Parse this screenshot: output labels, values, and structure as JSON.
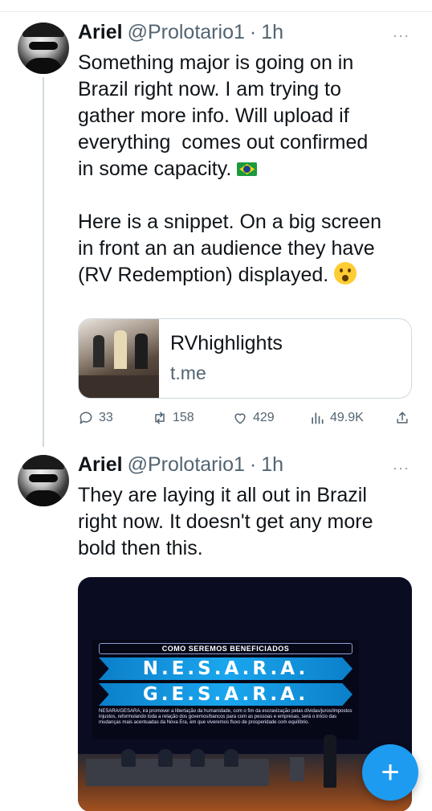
{
  "tweets": [
    {
      "name": "Ariel",
      "handle": "@Prolotario1",
      "time_sep": "·",
      "time": "1h",
      "more": "···",
      "text_part1": "Something major is going on in\nBrazil right now. I am trying to\ngather more info. Will upload if\neverything  comes out confirmed\nin some capacity. ",
      "text_part2": "\n\nHere is a snippet. On a big screen\nin front an an audience they have\n(RV Redemption) displayed. ",
      "card": {
        "title": "RVhighlights",
        "domain": "t.me"
      },
      "stats": {
        "replies": "33",
        "retweets": "158",
        "likes": "429",
        "views": "49.9K"
      }
    },
    {
      "name": "Ariel",
      "handle": "@Prolotario1",
      "time_sep": "·",
      "time": "1h",
      "more": "···",
      "text": "They are laying it all out in Brazil\nright now. It doesn't get any more\nbold then this.",
      "media": {
        "heading": "COMO SEREMOS BENEFICIADOS",
        "banner1": "N.E.S.A.R.A.",
        "banner2": "G.E.S.A.R.A.",
        "caption": "NESARA/GESARA, irá promover a libertação da humanidade, com o fim da escravização pelas dívidas/juros/impostos injustos, reformulando toda a relação dos governos/bancos para com as pessoas e empresas, será o início das mudanças mais acentuadas da Nova Era, em que viveremos fluxo de prosperidade com equilíbrio."
      }
    }
  ],
  "fab": {
    "label": "+"
  },
  "colors": {
    "accent": "#1d9bf0",
    "secondary_text": "#536471",
    "divider": "#cfd9de"
  }
}
